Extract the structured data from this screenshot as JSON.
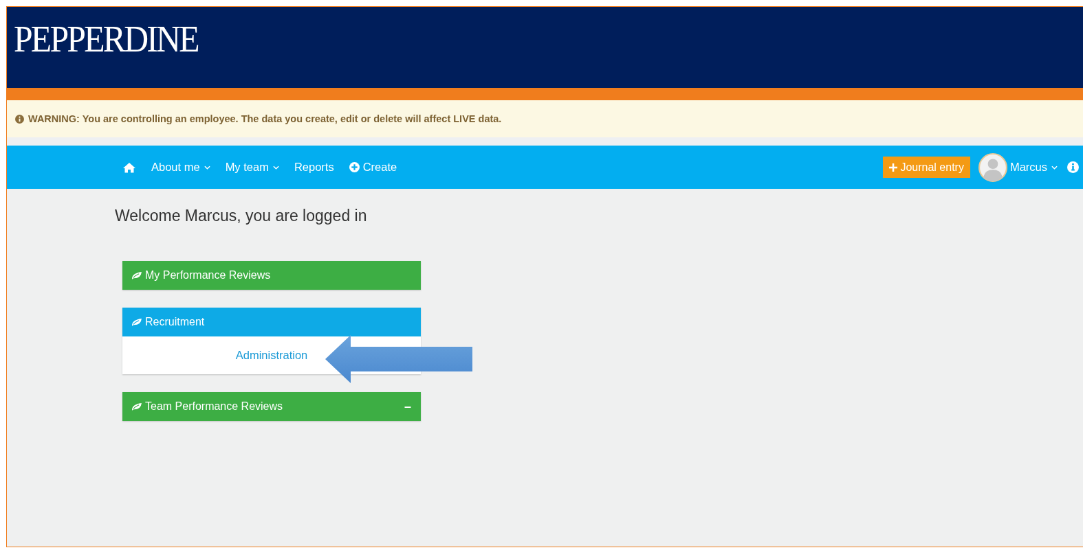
{
  "header": {
    "logo": "PEPPERDINE"
  },
  "warning": {
    "text": "WARNING: You are controlling an employee. The data you create, edit or delete will affect LIVE data."
  },
  "nav": {
    "items": [
      {
        "kind": "home"
      },
      {
        "kind": "dropdown",
        "label": "About me"
      },
      {
        "kind": "dropdown",
        "label": "My team"
      },
      {
        "kind": "link",
        "label": "Reports"
      },
      {
        "kind": "create",
        "label": "Create"
      }
    ],
    "journal_button": "Journal entry",
    "user": "Marcus"
  },
  "welcome": "Welcome Marcus, you are logged in",
  "panels": [
    {
      "title": "My Performance Reviews",
      "color": "#3dae44"
    },
    {
      "title": "Recruitment",
      "color": "#0eaae6",
      "links": [
        "Administration"
      ]
    },
    {
      "title": "Team Performance Reviews",
      "color": "#3dae44",
      "toggle": "–"
    }
  ]
}
